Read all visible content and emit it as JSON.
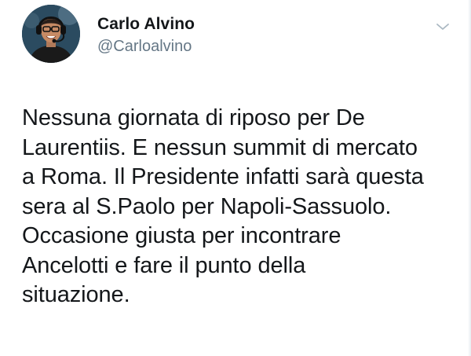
{
  "tweet": {
    "author": {
      "display_name": "Carlo Alvino",
      "handle": "@Carloalvino"
    },
    "menu_icon": "chevron-down-icon",
    "text": "Nessuna giornata di riposo per De\nLaurentiis. E nessun summit di mercato\na Roma. Il Presidente infatti sarà questa\nsera al S.Paolo per Napoli-Sassuolo.\nOccasione giusta per incontrare\nAncelotti e fare il punto della\nsituazione."
  },
  "colors": {
    "text": "#14171a",
    "secondary_text": "#657786",
    "icon": "#aab8c2",
    "background": "#ffffff"
  }
}
